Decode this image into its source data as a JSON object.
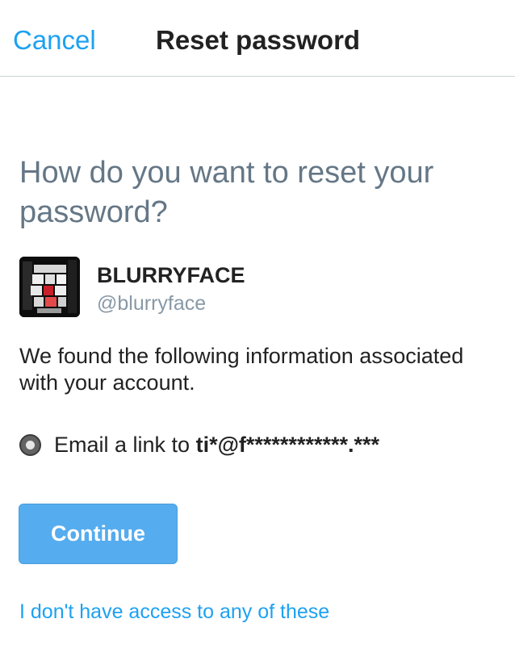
{
  "header": {
    "cancel_label": "Cancel",
    "title": "Reset password"
  },
  "main": {
    "question": "How do you want to reset your password?",
    "account": {
      "display_name": "BLURRYFACE",
      "handle": "@blurryface"
    },
    "info_text": "We found the following information associated with your account.",
    "option": {
      "prefix": "Email a link to ",
      "masked_email": "ti*@f************.***",
      "selected": true
    },
    "continue_label": "Continue",
    "no_access_link": "I don't have access to any of these"
  },
  "colors": {
    "accent": "#1da1f2",
    "button": "#55acee",
    "muted": "#657786"
  }
}
